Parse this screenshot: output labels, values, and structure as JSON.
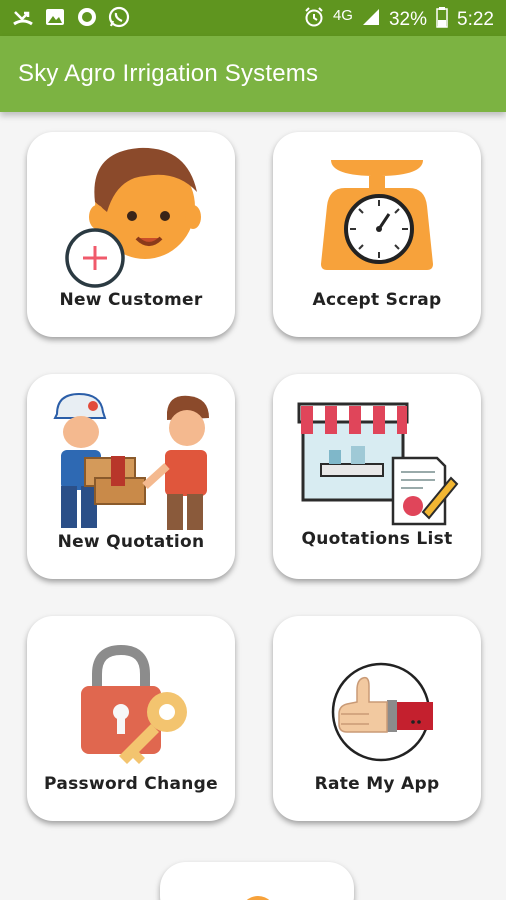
{
  "status_bar": {
    "network": "4G",
    "battery": "32%",
    "time": "5:22"
  },
  "app_bar": {
    "title": "Sky Agro Irrigation Systems"
  },
  "menu": [
    {
      "label": "New Customer",
      "icon": "new-customer-icon"
    },
    {
      "label": "Accept Scrap",
      "icon": "weighing-scale-icon"
    },
    {
      "label": "New Quotation",
      "icon": "delivery-handover-icon"
    },
    {
      "label": "Quotations List",
      "icon": "shop-document-icon"
    },
    {
      "label": "Password Change",
      "icon": "lock-key-icon"
    },
    {
      "label": "Rate My App",
      "icon": "thumbs-up-icon"
    }
  ],
  "colors": {
    "status_bar": "#5f951f",
    "app_bar": "#7cb342",
    "background": "#f5f5f5",
    "card": "#ffffff"
  }
}
